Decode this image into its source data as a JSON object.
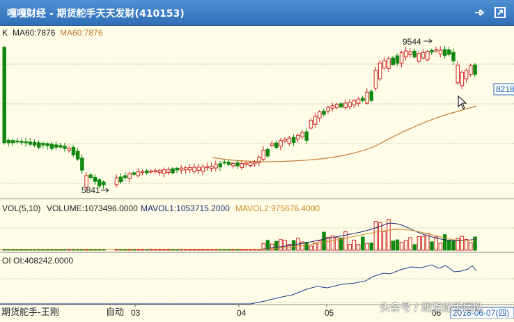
{
  "window": {
    "title": "嘎嘎财经 - 期货舵手天天发财(410153)",
    "pin_icon": "pin-icon",
    "maximize_icon": "maximize-icon"
  },
  "price_panel": {
    "prefix": "K",
    "ma60_label_1": "MA60:7876",
    "ma60_label_2": "MA60:7876",
    "high_label": "9544",
    "low_label": "5841",
    "price_tag": "8218"
  },
  "volume_panel": {
    "title": "VOL(5,10)",
    "volume": "VOLUME:1073496.0000",
    "mavol1": "MAVOL1:1053715.2000",
    "mavol2": "MAVOL2:975676.4000"
  },
  "oi_panel": {
    "prefix": "OI",
    "oi": "OI:408242.0000"
  },
  "x_axis": {
    "labels": [
      "03",
      "04",
      "05",
      "06"
    ],
    "date_label": "2018-06-07(四)"
  },
  "footer": {
    "left_text": "期货舵手-王刚",
    "auto_label": "自动",
    "watermark": "头条号 / 期货舵手团队"
  },
  "colors": {
    "up": "#cc2222",
    "down": "#118811",
    "ma60": "#c87832",
    "mavol1": "#1c2a6e",
    "mavol2": "#d08a2a",
    "oi_line": "#1c3a8a",
    "background": "#fffde8"
  },
  "chart_data": {
    "type": "candlestick",
    "price_range": [
      5500,
      9900
    ],
    "ma60": 7876,
    "high": 9544,
    "low": 5841,
    "last_price": 8218,
    "volume": 1073496,
    "mavol1": 1053715.2,
    "mavol2": 975676.4,
    "oi": 408242
  }
}
